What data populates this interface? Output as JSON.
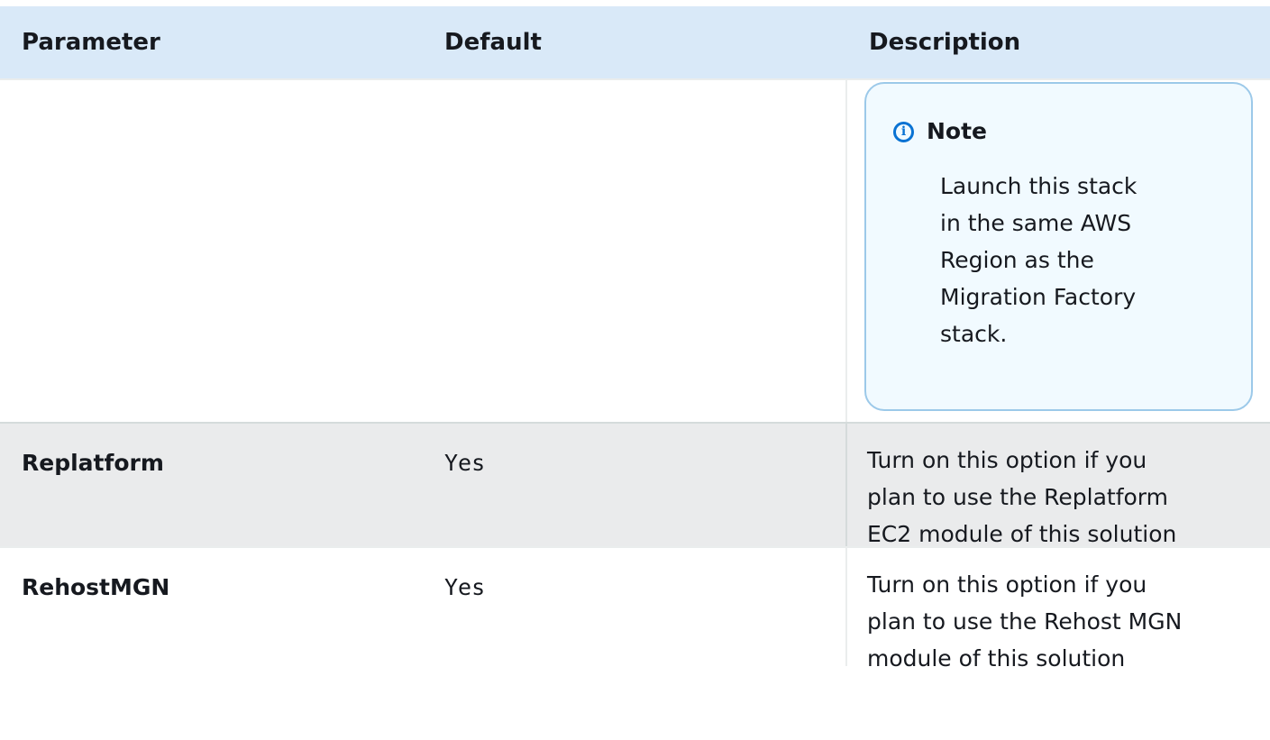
{
  "table": {
    "headers": {
      "parameter": "Parameter",
      "default": "Default",
      "description": "Description"
    },
    "note": {
      "icon": "info-icon",
      "title": "Note",
      "body_lines": [
        "Launch this stack",
        "in the same AWS",
        "Region as the",
        "Migration Factory",
        "stack."
      ]
    },
    "rows": [
      {
        "parameter": "Replatform",
        "default": "Yes",
        "description_lines": [
          "Turn on this option if you",
          "plan to use the Replatform",
          "EC2 module of this solution"
        ]
      },
      {
        "parameter": "RehostMGN",
        "default": "Yes",
        "description_lines": [
          "Turn on this option if you",
          "plan to use the Rehost MGN",
          "module of this solution"
        ]
      }
    ]
  }
}
